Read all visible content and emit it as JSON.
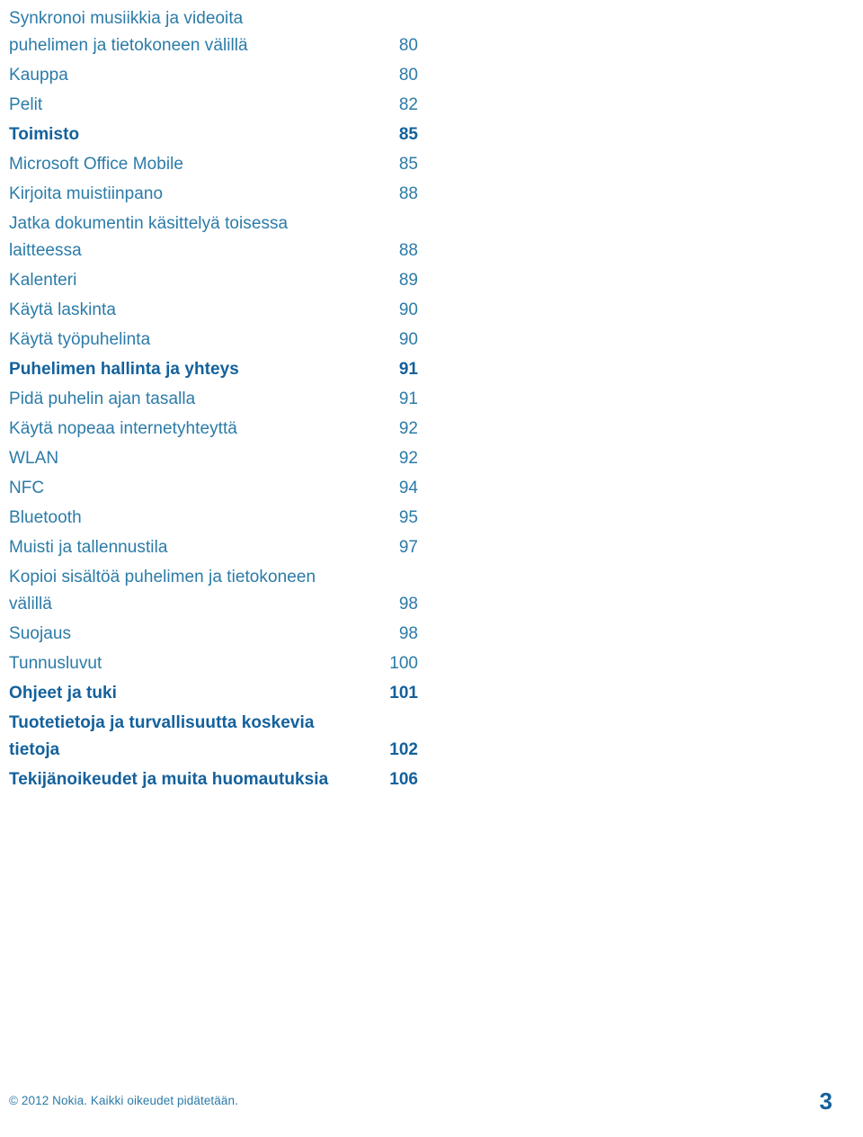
{
  "document": {
    "type": "table-of-contents",
    "language": "fi",
    "colors": {
      "regular_entry": "#2b7ba8",
      "bold_entry": "#14619c",
      "background": "#ffffff"
    }
  },
  "toc": {
    "entries": [
      {
        "title": "Synkronoi musiikkia ja videoita\npuhelimen ja tietokoneen välillä",
        "page": "80",
        "bold": false
      },
      {
        "title": "Kauppa",
        "page": "80",
        "bold": false
      },
      {
        "title": "Pelit",
        "page": "82",
        "bold": false
      },
      {
        "title": "Toimisto",
        "page": "85",
        "bold": true
      },
      {
        "title": "Microsoft Office Mobile",
        "page": "85",
        "bold": false
      },
      {
        "title": "Kirjoita muistiinpano",
        "page": "88",
        "bold": false
      },
      {
        "title": "Jatka dokumentin käsittelyä toisessa\nlaitteessa",
        "page": "88",
        "bold": false
      },
      {
        "title": "Kalenteri",
        "page": "89",
        "bold": false
      },
      {
        "title": "Käytä laskinta",
        "page": "90",
        "bold": false
      },
      {
        "title": "Käytä työpuhelinta",
        "page": "90",
        "bold": false
      },
      {
        "title": "Puhelimen hallinta ja yhteys",
        "page": "91",
        "bold": true
      },
      {
        "title": "Pidä puhelin ajan tasalla",
        "page": "91",
        "bold": false
      },
      {
        "title": "Käytä nopeaa internetyhteyttä",
        "page": "92",
        "bold": false
      },
      {
        "title": "WLAN",
        "page": "92",
        "bold": false
      },
      {
        "title": "NFC",
        "page": "94",
        "bold": false
      },
      {
        "title": "Bluetooth",
        "page": "95",
        "bold": false
      },
      {
        "title": "Muisti ja tallennustila",
        "page": "97",
        "bold": false
      },
      {
        "title": "Kopioi sisältöä puhelimen ja tietokoneen\nvälillä",
        "page": "98",
        "bold": false
      },
      {
        "title": "Suojaus",
        "page": "98",
        "bold": false
      },
      {
        "title": "Tunnusluvut",
        "page": "100",
        "bold": false
      },
      {
        "title": "Ohjeet ja tuki",
        "page": "101",
        "bold": true
      },
      {
        "title": "Tuotetietoja ja turvallisuutta koskevia\ntietoja",
        "page": "102",
        "bold": true
      },
      {
        "title": "Tekijänoikeudet ja muita huomautuksia",
        "page": "106",
        "bold": true
      }
    ]
  },
  "footer": {
    "copyright": "© 2012 Nokia. Kaikki oikeudet pidätetään.",
    "page_number": "3"
  }
}
